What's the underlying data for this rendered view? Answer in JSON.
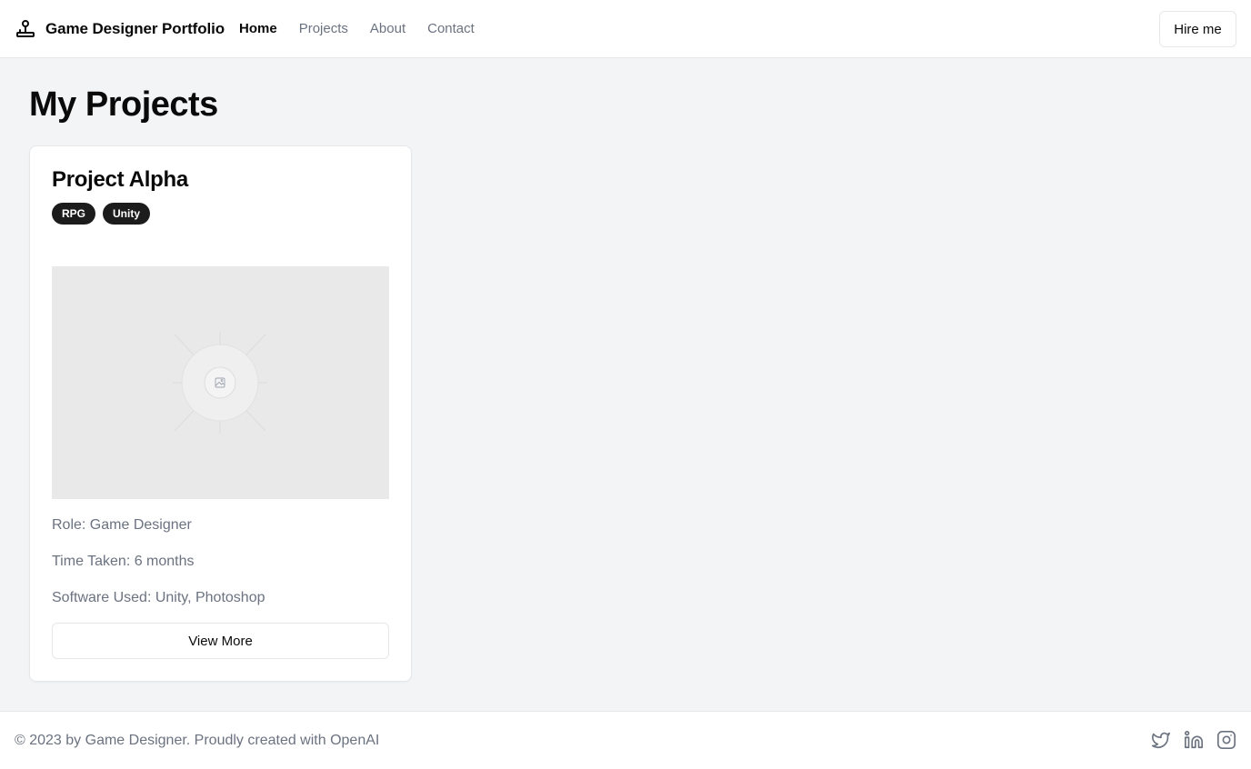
{
  "header": {
    "brand_icon": "joystick-icon",
    "brand_title": "Game Designer Portfolio",
    "nav": [
      {
        "label": "Home",
        "active": true
      },
      {
        "label": "Projects",
        "active": false
      },
      {
        "label": "About",
        "active": false
      },
      {
        "label": "Contact",
        "active": false
      }
    ],
    "hire_label": "Hire me"
  },
  "main": {
    "title": "My Projects",
    "projects": [
      {
        "title": "Project Alpha",
        "tags": [
          "RPG",
          "Unity"
        ],
        "image_icon": "image-placeholder-icon",
        "role": "Role: Game Designer",
        "time": "Time Taken: 6 months",
        "software": "Software Used: Unity, Photoshop",
        "button_label": "View More"
      }
    ]
  },
  "footer": {
    "text": "© 2023 by Game Designer. Proudly created with OpenAI",
    "socials": [
      "twitter-icon",
      "linkedin-icon",
      "instagram-icon"
    ]
  },
  "colors": {
    "background": "#f3f4f6",
    "surface": "#ffffff",
    "border": "#e5e7eb",
    "text": "#0a0a0a",
    "muted": "#6b7280",
    "tag_bg": "#1c1c1c"
  }
}
